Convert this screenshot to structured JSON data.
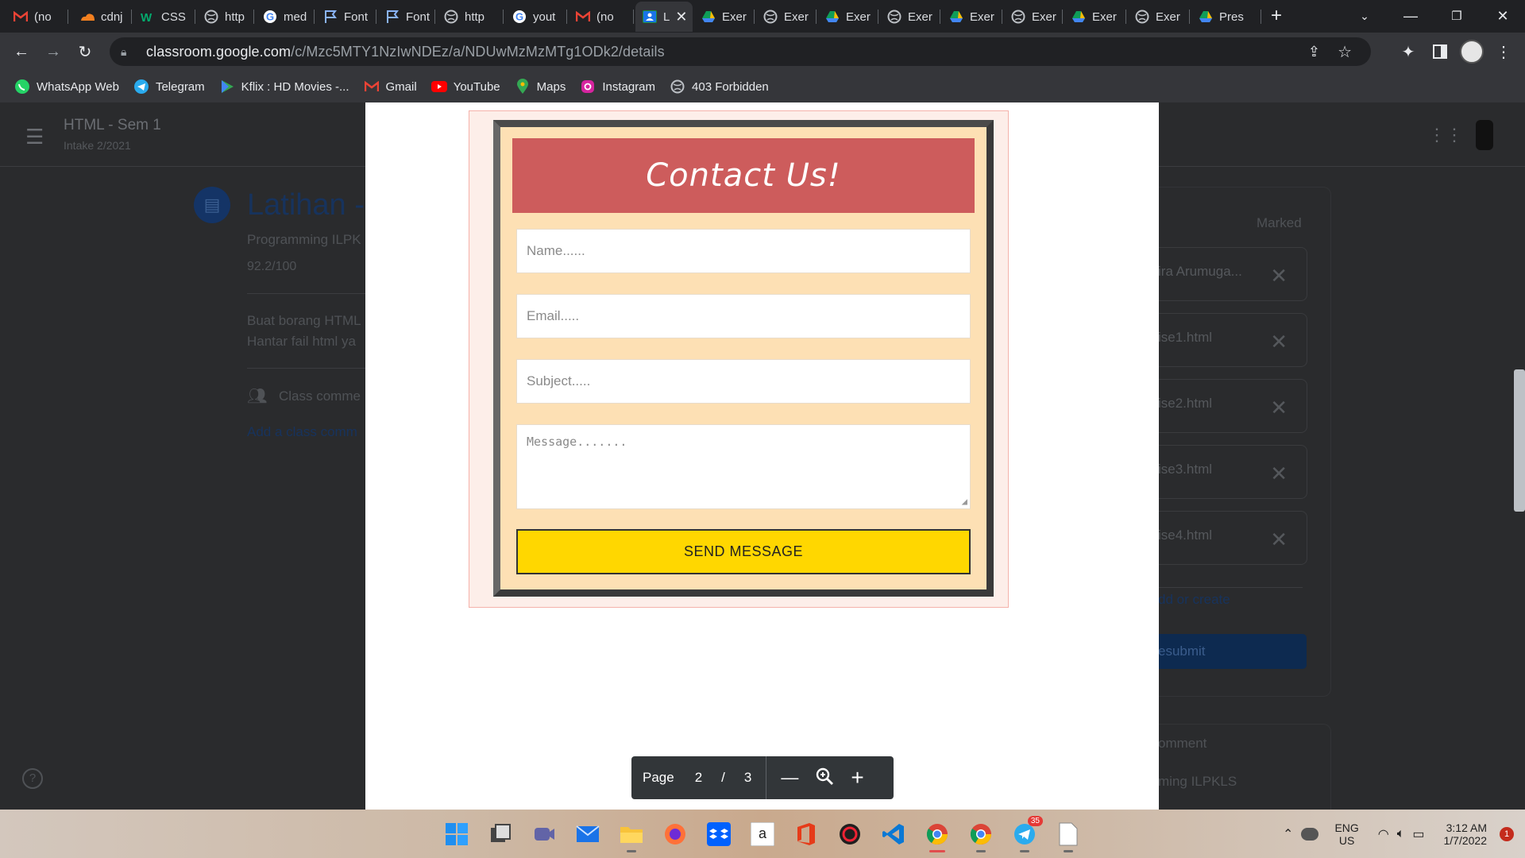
{
  "tabs": [
    {
      "title": "(no",
      "icon": "gmail-icon"
    },
    {
      "title": "cdnj",
      "icon": "cloudflare-icon"
    },
    {
      "title": "CSS",
      "icon": "w3schools-icon"
    },
    {
      "title": "http",
      "icon": "globe-icon"
    },
    {
      "title": "med",
      "icon": "google-icon"
    },
    {
      "title": "Font",
      "icon": "flag-icon"
    },
    {
      "title": "Font",
      "icon": "flag-icon"
    },
    {
      "title": "http",
      "icon": "globe-icon"
    },
    {
      "title": "yout",
      "icon": "google-icon"
    },
    {
      "title": "(no",
      "icon": "gmail-icon"
    },
    {
      "title": "L",
      "icon": "classroom-icon",
      "active": true
    },
    {
      "title": "Exer",
      "icon": "drive-icon"
    },
    {
      "title": "Exer",
      "icon": "globe-icon"
    },
    {
      "title": "Exer",
      "icon": "drive-icon"
    },
    {
      "title": "Exer",
      "icon": "globe-icon"
    },
    {
      "title": "Exer",
      "icon": "drive-icon"
    },
    {
      "title": "Exer",
      "icon": "globe-icon"
    },
    {
      "title": "Exer",
      "icon": "drive-icon"
    },
    {
      "title": "Exer",
      "icon": "globe-icon"
    },
    {
      "title": "Pres",
      "icon": "drive-icon"
    }
  ],
  "address": {
    "domain": "classroom.google.com",
    "path": "/c/Mzc5MTY1NzIwNDEz/a/NDUwMzMzMTg1ODk2/details"
  },
  "bookmarks": [
    {
      "label": "WhatsApp Web",
      "icon": "whatsapp-icon"
    },
    {
      "label": "Telegram",
      "icon": "telegram-icon"
    },
    {
      "label": "Kflix : HD Movies -...",
      "icon": "play-icon"
    },
    {
      "label": "Gmail",
      "icon": "gmail-icon"
    },
    {
      "label": "YouTube",
      "icon": "youtube-icon"
    },
    {
      "label": "Maps",
      "icon": "maps-icon"
    },
    {
      "label": "Instagram",
      "icon": "instagram-icon"
    },
    {
      "label": "403 Forbidden",
      "icon": "globe-icon"
    }
  ],
  "classroom": {
    "class_name": "HTML - Sem 1",
    "intake": "Intake 2/2021",
    "assignment_title": "Latihan -",
    "topic": "Programming ILPK",
    "grade": "92.2/100",
    "desc_line1": "Buat borang HTML",
    "desc_line2": "Hantar fail html ya",
    "class_comments": "Class comme",
    "add_comment": "Add a class comm",
    "status": "Marked",
    "work_items": [
      "ira Arumuga...",
      "ise1.html",
      "ise2.html",
      "ise3.html",
      "ise4.html"
    ],
    "add_or_create": "dd or create",
    "resubmit": "esubmit",
    "private_comment": "omment",
    "private_sub": "ming ILPKLS"
  },
  "form": {
    "title": "Contact Us!",
    "name_placeholder": "Name......",
    "email_placeholder": "Email.....",
    "subject_placeholder": "Subject.....",
    "message_placeholder": "Message.......",
    "send_label": "SEND MESSAGE"
  },
  "viewer": {
    "page_label": "Page",
    "current_page": "2",
    "separator": "/",
    "total_pages": "3"
  },
  "taskbar": {
    "lang_top": "ENG",
    "lang_bottom": "US",
    "time": "3:12 AM",
    "date": "1/7/2022",
    "notifications": "1",
    "telegram_badge": "35"
  },
  "colors": {
    "form_header": "#cd5c5c",
    "form_bg": "#fde0b4",
    "send_button": "#ffd700",
    "classroom_blue": "#1a73e8"
  }
}
